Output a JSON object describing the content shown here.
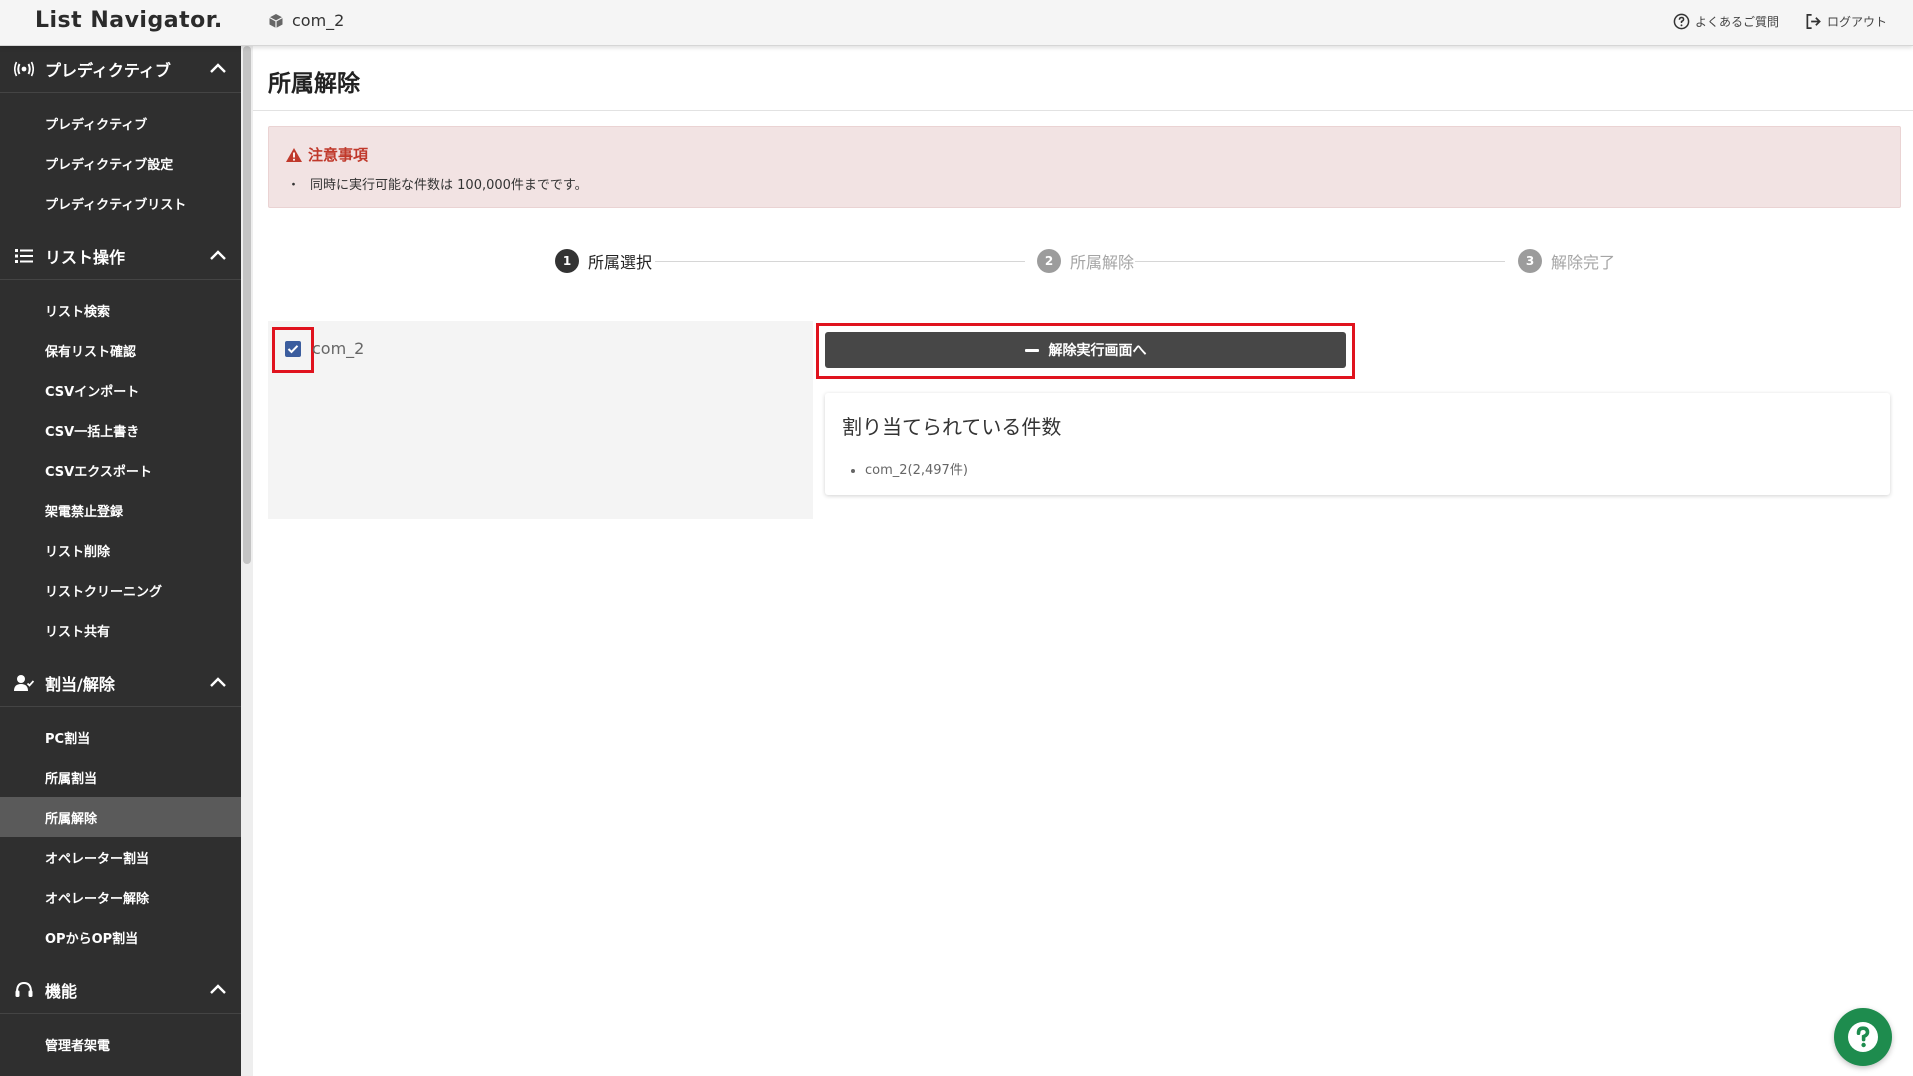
{
  "header": {
    "logo": "List Navigator.",
    "tenant": "com_2",
    "faq_label": "よくあるご質問",
    "logout_label": "ログアウト"
  },
  "sidebar": {
    "sections": [
      {
        "title": "プレディクティブ",
        "icon": "broadcast-icon",
        "items": [
          "プレディクティブ",
          "プレディクティブ設定",
          "プレディクティブリスト"
        ]
      },
      {
        "title": "リスト操作",
        "icon": "list-icon",
        "items": [
          "リスト検索",
          "保有リスト確認",
          "CSVインポート",
          "CSV一括上書き",
          "CSVエクスポート",
          "架電禁止登録",
          "リスト削除",
          "リストクリーニング",
          "リスト共有"
        ]
      },
      {
        "title": "割当/解除",
        "icon": "user-check-icon",
        "items": [
          "PC割当",
          "所属割当",
          "所属解除",
          "オペレーター割当",
          "オペレーター解除",
          "OPからOP割当"
        ],
        "active_item": "所属解除"
      },
      {
        "title": "機能",
        "icon": "headset-icon",
        "items": [
          "管理者架電"
        ]
      }
    ]
  },
  "main": {
    "title": "所属解除",
    "notice": {
      "title": "注意事項",
      "bullet": "・",
      "text": "同時に実行可能な件数は 100,000件までです。"
    },
    "steps": [
      {
        "num": "1",
        "label": "所属選択",
        "state": "current"
      },
      {
        "num": "2",
        "label": "所属解除",
        "state": "pending"
      },
      {
        "num": "3",
        "label": "解除完了",
        "state": "pending"
      }
    ],
    "selection": {
      "checkbox_label": "com_2",
      "checked": true
    },
    "action_button": "解除実行画面へ",
    "card": {
      "title": "割り当てられている件数",
      "items": [
        "com_2(2,497件)"
      ]
    }
  },
  "colors": {
    "sidebar_bg": "#2f2f2f",
    "active_item_bg": "#5a5a5a",
    "notice_bg": "#f2e3e3",
    "notice_accent": "#c0392b",
    "highlight": "#e0131e",
    "checkbox": "#3b5d9e",
    "fab": "#1e8c4e"
  }
}
